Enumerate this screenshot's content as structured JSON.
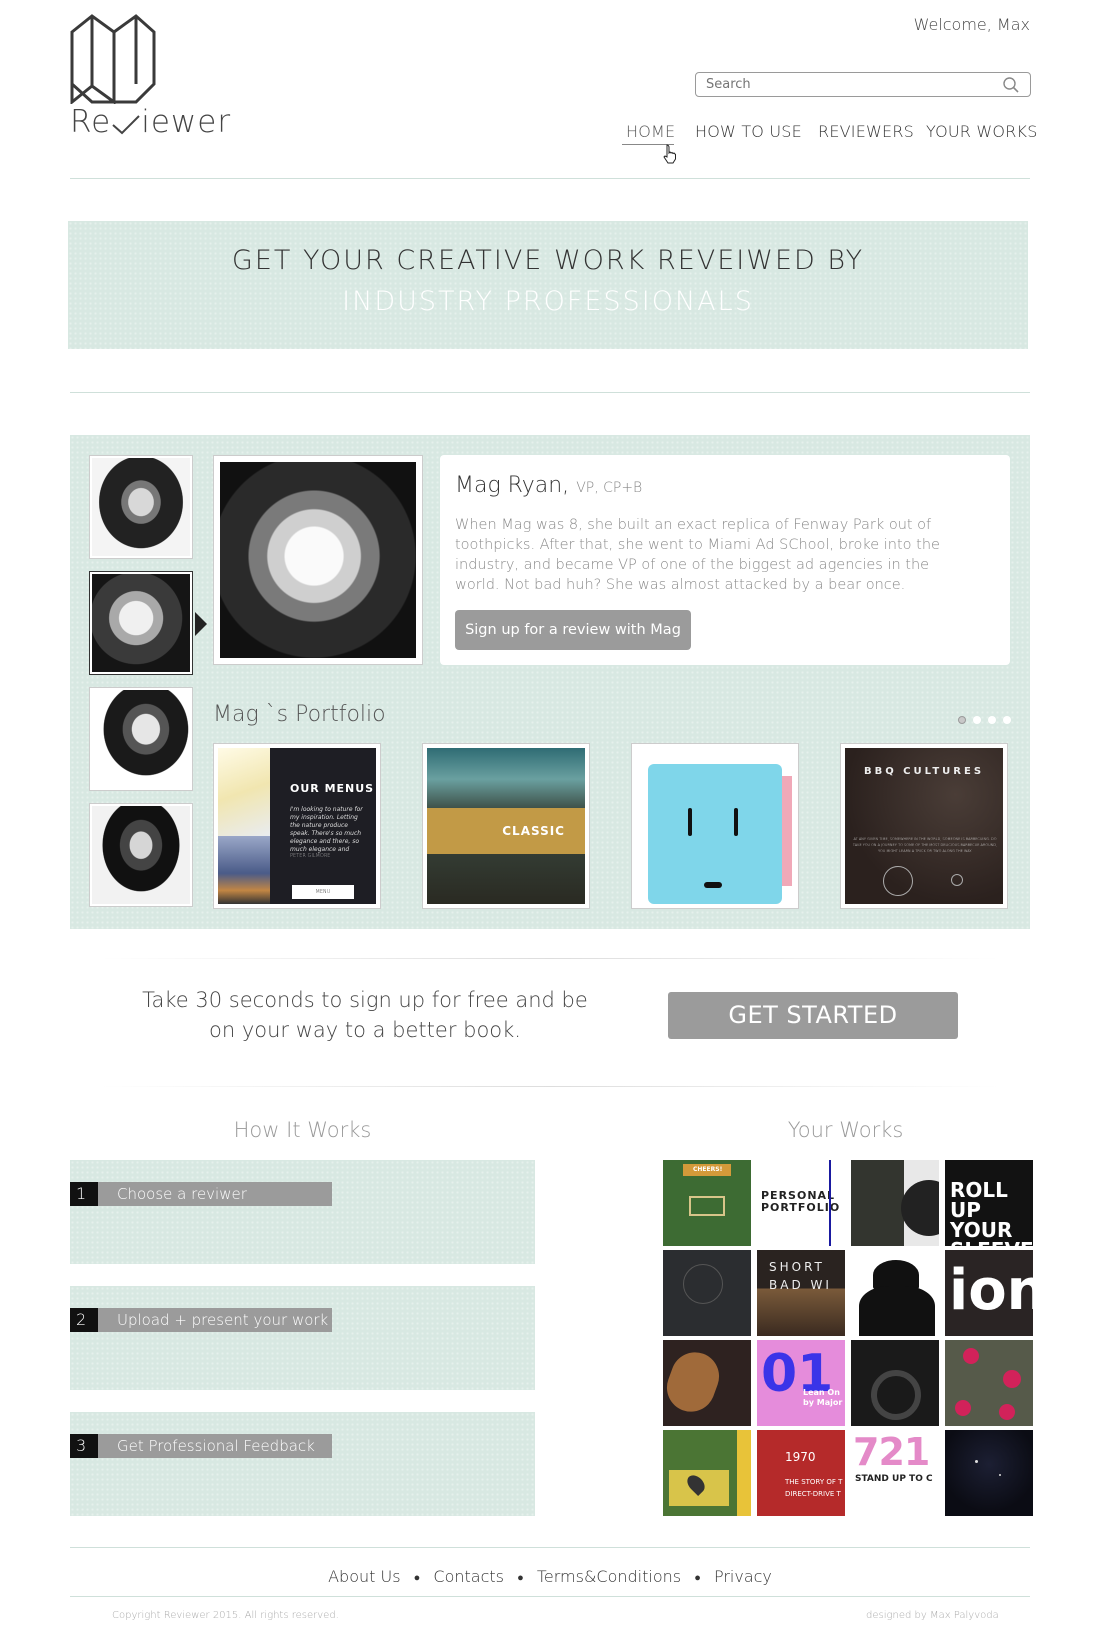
{
  "header": {
    "logo_text_left": "Re",
    "logo_text_right": "iewer",
    "welcome": "Welcome, Max",
    "search_placeholder": "Search",
    "nav": [
      "HOME",
      "HOW TO USE",
      "REVIEWERS",
      "YOUR WORKS"
    ]
  },
  "hero": {
    "line1": "GET YOUR CREATIVE WORK REVEIWED BY",
    "line2": "INDUSTRY PROFESSIONALS"
  },
  "reviewer": {
    "name": "Mag Ryan,",
    "role": "VP, CP+B",
    "bio": "When Mag was 8, she built an exact replica of Fenway Park out of toothpicks. After that, she went to Miami Ad SChool, broke into the industry, and became VP of one of the biggest ad agencies in the world. Not bad huh? She was almost attacked by a bear once.",
    "button": "Sign up for a review with Mag",
    "portfolio_title": "Mag `s Portfolio",
    "portfolio_items": [
      {
        "heading": "OUR MENUS",
        "body": "I'm looking to nature for my inspiration. Letting the nature produce speak. There's so much elegance and there, so much elegance and",
        "sign": "PETER GILMORE",
        "cta": "MENU"
      },
      {
        "heading": "CLASSIC"
      },
      {
        "heading": ""
      },
      {
        "heading": "BBQ CULTURES",
        "body": "AT ANY GIVEN TIME, SOMEWHERE IN THE WORLD, SOMEONE IS BARBECUING. DO TAKE YOU ON A JOURNEY TO SOME OF THE MOST DELICIOUS BARBECUE AROUND, YOU MIGHT LEARN A TRICK OR TWO ALONG THE WAY."
      }
    ]
  },
  "cta": {
    "line1": "Take 30 seconds to sign up for free and be",
    "line2": "on your way to a better book.",
    "button": "GET STARTED"
  },
  "how_it_works": {
    "title": "How It Works",
    "steps": [
      {
        "num": "1",
        "label": "Choose a reviwer"
      },
      {
        "num": "2",
        "label": "Upload + present your work"
      },
      {
        "num": "3",
        "label": "Get Professional Feedback"
      }
    ]
  },
  "your_works": {
    "title": "Your Works",
    "tiles": [
      "CHEERS!",
      "PERSONAL PORTFOLIO",
      "",
      "ROLL UP YOUR SLEEVES",
      "",
      "SHORT BAD WI",
      "",
      "ion",
      "",
      "01",
      "Lean On by Major",
      "",
      "",
      "1970",
      "THE STORY OF T DIRECT-DRIVE T",
      "721",
      "STAND UP TO C",
      ""
    ]
  },
  "footer": {
    "links": [
      "About Us",
      "Contacts",
      "Terms&Conditions",
      "Privacy"
    ],
    "copyright": "Copyright  Reviewer 2015. All rights reserved.",
    "designed": "designed by Max Palyvoda"
  }
}
